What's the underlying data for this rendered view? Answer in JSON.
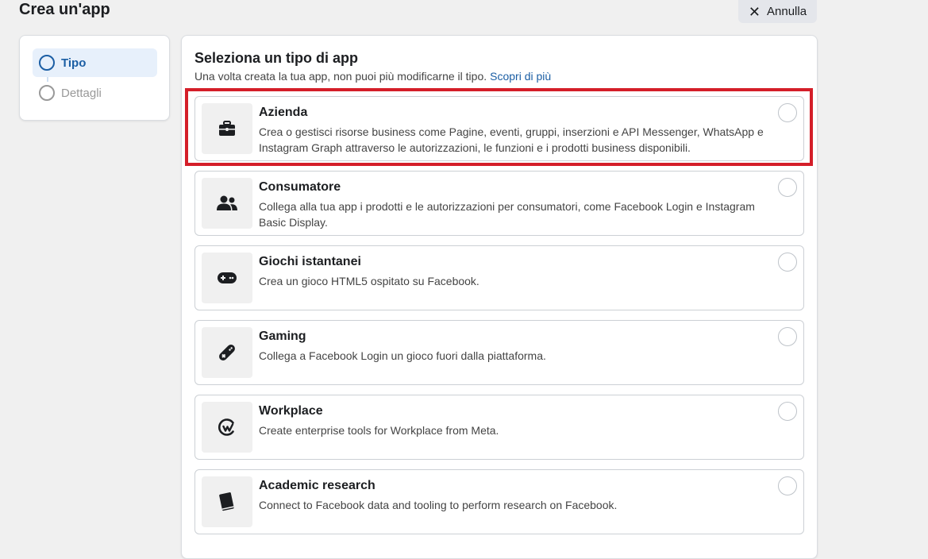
{
  "header": {
    "title": "Crea un'app",
    "cancel_label": "Annulla",
    "cancel_icon": "close-icon"
  },
  "steps": [
    {
      "label": "Tipo",
      "state": "active"
    },
    {
      "label": "Dettagli",
      "state": "inactive"
    }
  ],
  "main": {
    "heading": "Seleziona un tipo di app",
    "subtitle": "Una volta creata la tua app, non puoi più modificarne il tipo.",
    "learn_more": "Scopri di più",
    "options": [
      {
        "title": "Azienda",
        "description": "Crea o gestisci risorse business come Pagine, eventi, gruppi, inserzioni e API Messenger, WhatsApp e Instagram Graph attraverso le autorizzazioni, le funzioni e i prodotti business disponibili.",
        "icon": "briefcase-icon"
      },
      {
        "title": "Consumatore",
        "description": "Collega alla tua app i prodotti e le autorizzazioni per consumatori, come Facebook Login e Instagram Basic Display.",
        "icon": "people-icon"
      },
      {
        "title": "Giochi istantanei",
        "description": "Crea un gioco HTML5 ospitato su Facebook.",
        "icon": "gamepad-icon"
      },
      {
        "title": "Gaming",
        "description": "Collega a Facebook Login un gioco fuori dalla piattaforma.",
        "icon": "controller-icon"
      },
      {
        "title": "Workplace",
        "description": "Create enterprise tools for Workplace from Meta.",
        "icon": "workplace-icon"
      },
      {
        "title": "Academic research",
        "description": "Connect to Facebook data and tooling to perform research on Facebook.",
        "icon": "book-icon"
      }
    ]
  },
  "colors": {
    "accent": "#1b5ea4",
    "highlight": "#d41e29",
    "background": "#f0f0f0"
  }
}
